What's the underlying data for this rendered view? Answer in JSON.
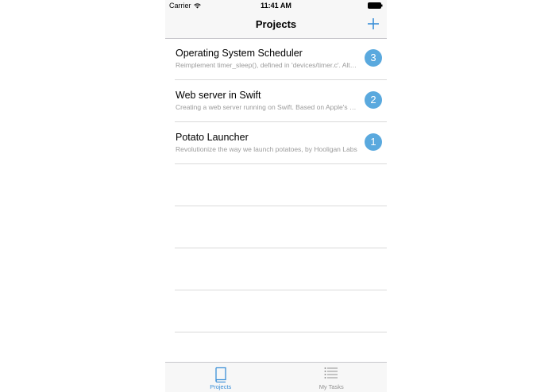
{
  "status_bar": {
    "carrier": "Carrier",
    "time": "11:41 AM"
  },
  "nav": {
    "title": "Projects",
    "add_icon": "plus-icon"
  },
  "projects": [
    {
      "title": "Operating System Scheduler",
      "subtitle": "Reimplement timer_sleep(), defined in 'devices/timer.c'. Although a working implementation is provided",
      "badge": "3"
    },
    {
      "title": "Web server in Swift",
      "subtitle": "Creating a web server running on Swift. Based on Apple's open source release",
      "badge": "2"
    },
    {
      "title": "Potato Launcher",
      "subtitle": "Revolutionize the way we launch potatoes, by Hooligan Labs",
      "badge": "1"
    }
  ],
  "tab_bar": {
    "tabs": [
      {
        "label": "Projects",
        "icon": "book-icon",
        "active": true
      },
      {
        "label": "My Tasks",
        "icon": "list-icon",
        "active": false
      }
    ]
  },
  "colors": {
    "accent": "#3a8fd8",
    "badge": "#5aa9de",
    "separator": "#dadada",
    "bar_background": "#f7f7f7"
  }
}
